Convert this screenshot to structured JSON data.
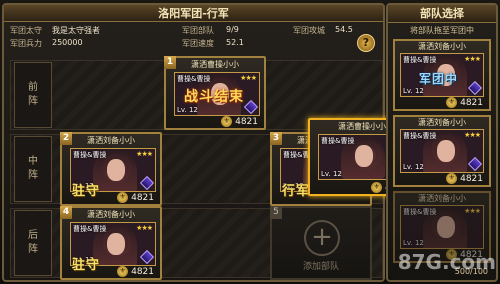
{
  "main": {
    "title": "洛阳军团-行军",
    "stats": {
      "commander_label": "军团太守",
      "commander_value": "我是太守强者",
      "troops_label": "军团兵力",
      "troops_value": "250000",
      "units_label": "军团部队",
      "units_value": "9/9",
      "speed_label": "军团速度",
      "speed_value": "52.1",
      "siege_label": "军团攻城",
      "siege_value": "54.5"
    },
    "help": "?",
    "rows": [
      {
        "label_top": "前",
        "label_bottom": "阵"
      },
      {
        "label_top": "中",
        "label_bottom": "阵"
      },
      {
        "label_top": "后",
        "label_bottom": "阵"
      }
    ],
    "cards": [
      {
        "num": "1",
        "name": "潇洒曹操小小",
        "tag": "曹操&曹操",
        "stars": "★★★",
        "lv": "Lv. 12",
        "power": "4821",
        "status": "战斗结束"
      },
      {
        "num": "2",
        "name": "潇洒刘备小小",
        "tag": "曹操&曹操",
        "stars": "★★★",
        "lv": "Lv. 12",
        "power": "4821",
        "status": "驻守"
      },
      {
        "num": "3",
        "name": "潇洒曹操小小",
        "tag": "曹操&曹操",
        "stars": "★★★",
        "lv": "Lv. 12",
        "power": "4821",
        "status": "行军"
      },
      {
        "num": "4",
        "name": "潇洒刘备小小",
        "tag": "曹操&曹操",
        "stars": "★★★",
        "lv": "Lv. 12",
        "power": "4821",
        "status": "驻守"
      },
      {
        "num": "",
        "name": "潇洒曹操小小",
        "tag": "曹操&曹操",
        "stars": "★★★",
        "lv": "Lv. 12",
        "power": "4821",
        "status": ""
      }
    ],
    "empty_slot": {
      "num": "5",
      "label": "添加部队",
      "plus": "+"
    }
  },
  "side": {
    "title": "部队选择",
    "subtitle": "将部队拖至军团中",
    "cards": [
      {
        "name": "潇洒刘备小小",
        "tag": "曹操&曹操",
        "stars": "★★★",
        "lv": "Lv. 12",
        "power": "4821",
        "status": "军团中"
      },
      {
        "name": "潇洒刘备小小",
        "tag": "曹操&曹操",
        "stars": "★★★",
        "lv": "Lv. 12",
        "power": "4821",
        "status": ""
      },
      {
        "name": "潇洒刘备小小",
        "tag": "曹操&曹操",
        "stars": "★★★",
        "lv": "Lv. 12",
        "power": "4821",
        "status": ""
      }
    ],
    "count": "500/100"
  },
  "watermark": "87G.com"
}
